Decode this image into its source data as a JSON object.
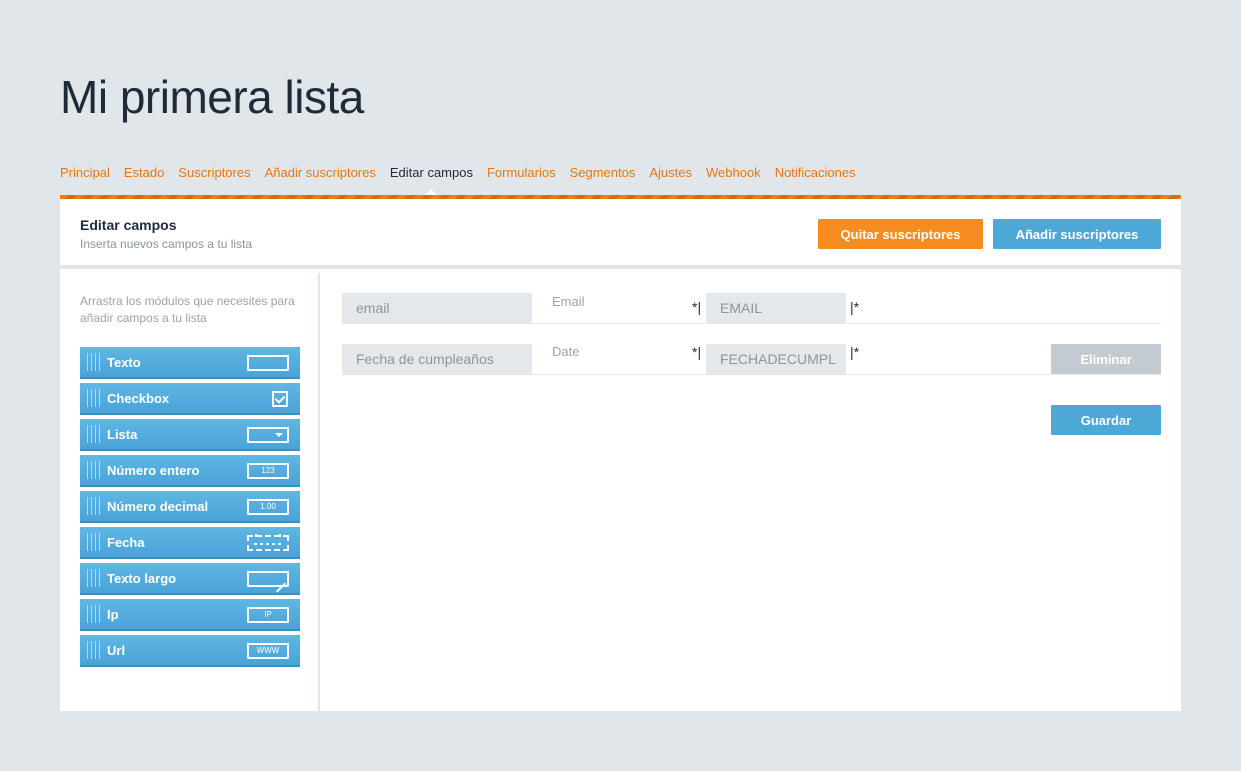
{
  "page": {
    "title": "Mi primera lista"
  },
  "tabs": [
    {
      "label": "Principal",
      "active": false
    },
    {
      "label": "Estado",
      "active": false
    },
    {
      "label": "Suscriptores",
      "active": false
    },
    {
      "label": "Añadir suscriptores",
      "active": false
    },
    {
      "label": "Editar campos",
      "active": true
    },
    {
      "label": "Formularios",
      "active": false
    },
    {
      "label": "Segmentos",
      "active": false
    },
    {
      "label": "Ajustes",
      "active": false
    },
    {
      "label": "Webhook",
      "active": false
    },
    {
      "label": "Notificaciones",
      "active": false
    }
  ],
  "header": {
    "title": "Editar campos",
    "subtitle": "Inserta nuevos campos a tu lista",
    "remove_subscribers_label": "Quitar suscriptores",
    "add_subscribers_label": "Añadir suscriptores"
  },
  "sidebar": {
    "hint": "Arrastra los módulos que necesites para añadir campos a tu lista",
    "modules": [
      {
        "label": "Texto",
        "icon": "text-field-icon",
        "icon_text": ""
      },
      {
        "label": "Checkbox",
        "icon": "checkbox-icon",
        "icon_text": ""
      },
      {
        "label": "Lista",
        "icon": "dropdown-icon",
        "icon_text": ""
      },
      {
        "label": "Número entero",
        "icon": "integer-icon",
        "icon_text": "123"
      },
      {
        "label": "Número decimal",
        "icon": "decimal-icon",
        "icon_text": "1.00"
      },
      {
        "label": "Fecha",
        "icon": "calendar-icon",
        "icon_text": ""
      },
      {
        "label": "Texto largo",
        "icon": "textarea-icon",
        "icon_text": ""
      },
      {
        "label": "Ip",
        "icon": "ip-icon",
        "icon_text": "IP"
      },
      {
        "label": "Url",
        "icon": "url-icon",
        "icon_text": "WWW"
      }
    ]
  },
  "fields": [
    {
      "name": "email",
      "type": "Email",
      "star_left": "*|",
      "merge_tag": "EMAIL",
      "star_right": "|*",
      "deletable": false
    },
    {
      "name": "Fecha de cumpleaños",
      "type": "Date",
      "star_left": "*|",
      "merge_tag": "FECHADECUMPL",
      "star_right": "|*",
      "deletable": true,
      "delete_label": "Eliminar"
    }
  ],
  "actions": {
    "save_label": "Guardar"
  },
  "colors": {
    "accent_orange": "#f68b1f",
    "accent_blue": "#4ea8d7",
    "background": "#e1e6ea",
    "disabled": "#c3cbd1"
  }
}
